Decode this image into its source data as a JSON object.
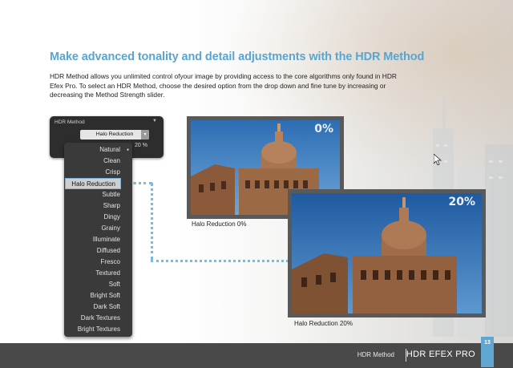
{
  "heading": "Make advanced tonality and detail adjustments with the HDR Method",
  "paragraph": "HDR Method allows you unlimited control ofyour image by providing access to the core algorithms only found in HDR Efex Pro. To select an HDR Method, choose the desired option from the drop down and fine tune by increasing or decreasing the Method Strength slider.",
  "control": {
    "label": "HDR Method",
    "collapse_icon": "triangle-down-icon",
    "selected_value": "Halo Reduction",
    "strength": "20",
    "percent_sign": "%"
  },
  "dropdown": {
    "items": [
      "Natural",
      "Clean",
      "Crisp",
      "Halo Reduction",
      "Subtle",
      "Sharp",
      "Dingy",
      "Grainy",
      "Illuminate",
      "Diffused",
      "Fresco",
      "Textured",
      "Soft",
      "Bright Soft",
      "Dark Soft",
      "Dark Textures",
      "Bright Textures"
    ],
    "selected": "Halo Reduction",
    "checked": "Natural"
  },
  "photos": [
    {
      "label": "0%",
      "caption": "Halo Reduction 0%"
    },
    {
      "label": "20%",
      "caption": "Halo Reduction 20%"
    }
  ],
  "footer": {
    "section": "HDR Method",
    "brand": "HDR EFEX PRO",
    "page_number": "13"
  },
  "colors": {
    "accent": "#5aa5cf",
    "footer_bg": "#494949",
    "dropdown_bg": "#3a3a3a"
  }
}
